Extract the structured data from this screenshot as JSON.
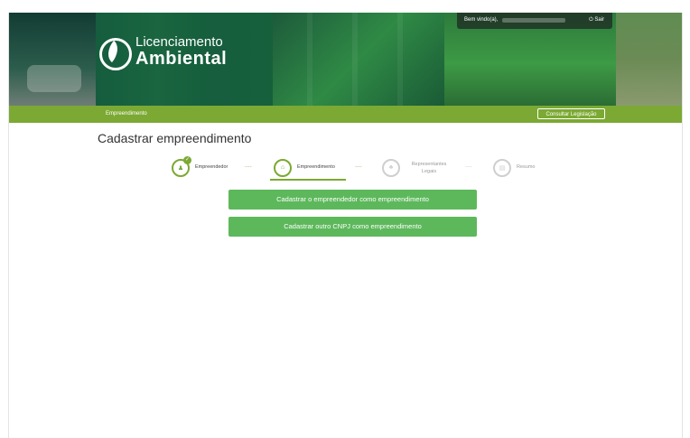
{
  "header": {
    "logo_line1": "Licenciamento",
    "logo_line2": "Ambiental",
    "welcome_text": "Bem vindo(a),",
    "exit_label": "Sair"
  },
  "nav": {
    "items": [
      "Empreendimento"
    ],
    "consult_button": "Consultar Legislação"
  },
  "page": {
    "title": "Cadastrar empreendimento"
  },
  "steps": [
    {
      "label": "Empreendedor",
      "state": "completed"
    },
    {
      "label": "Empreendimento",
      "state": "active"
    },
    {
      "label": "Representantes Legais",
      "state": "inactive"
    },
    {
      "label": "Resumo",
      "state": "inactive"
    }
  ],
  "step_separator": "....",
  "actions": {
    "register_entrepreneur": "Cadastrar o empreendedor como empreendimento",
    "register_other_cnpj": "Cadastrar outro CNPJ como empreendimento"
  },
  "colors": {
    "nav_green": "#7ba933",
    "button_green": "#5db85c"
  }
}
